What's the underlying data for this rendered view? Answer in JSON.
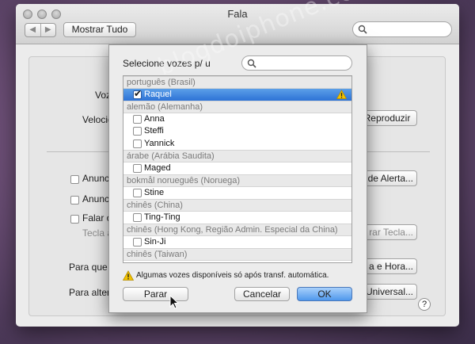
{
  "window": {
    "title": "Fala",
    "back_glyph": "◀",
    "forward_glyph": "▶",
    "show_all_label": "Mostrar Tudo"
  },
  "background_pane": {
    "voice_label": "Voz",
    "speed_label": "Velocid",
    "play_label": "Reproduzir",
    "announce1_label": "Anunci",
    "announce2_label": "Anunci",
    "speak_label": "Falar o",
    "key_label": "Tecla a",
    "alert_button": "de Alerta...",
    "key_button": "rar Tecla...",
    "for_what_label": "Para que o",
    "date_button": "a e Hora...",
    "change_label": "Para altera",
    "universal_button": "Universal...",
    "help_glyph": "?"
  },
  "sheet": {
    "prompt": "Selecione vozes p/ u",
    "search_placeholder": "",
    "groups": [
      {
        "header": "português (Brasil)",
        "voices": [
          {
            "name": "Raquel",
            "checked": true,
            "selected": true,
            "warning": true
          }
        ]
      },
      {
        "header": "alemão (Alemanha)",
        "voices": [
          {
            "name": "Anna"
          },
          {
            "name": "Steffi"
          },
          {
            "name": "Yannick"
          }
        ]
      },
      {
        "header": "árabe (Arábia Saudita)",
        "voices": [
          {
            "name": "Maged"
          }
        ]
      },
      {
        "header": "bokmål norueguês (Noruega)",
        "voices": [
          {
            "name": "Stine"
          }
        ]
      },
      {
        "header": "chinês (China)",
        "voices": [
          {
            "name": "Ting-Ting"
          }
        ]
      },
      {
        "header": "chinês (Hong Kong, Região Admin. Especial da China)",
        "voices": [
          {
            "name": "Sin-Ji"
          }
        ]
      },
      {
        "header": "chinês (Taiwan)",
        "voices": []
      }
    ],
    "notice": "Algumas vozes disponíveis só após transf. automática.",
    "stop_button": "Parar",
    "cancel_button": "Cancelar",
    "ok_button": "OK",
    "check_glyph": "✔"
  },
  "watermark": "blogdoiphone.com",
  "colors": {
    "selection": "#2d72d6",
    "warning": "#f2c200",
    "default_button": "#5da0ee"
  }
}
